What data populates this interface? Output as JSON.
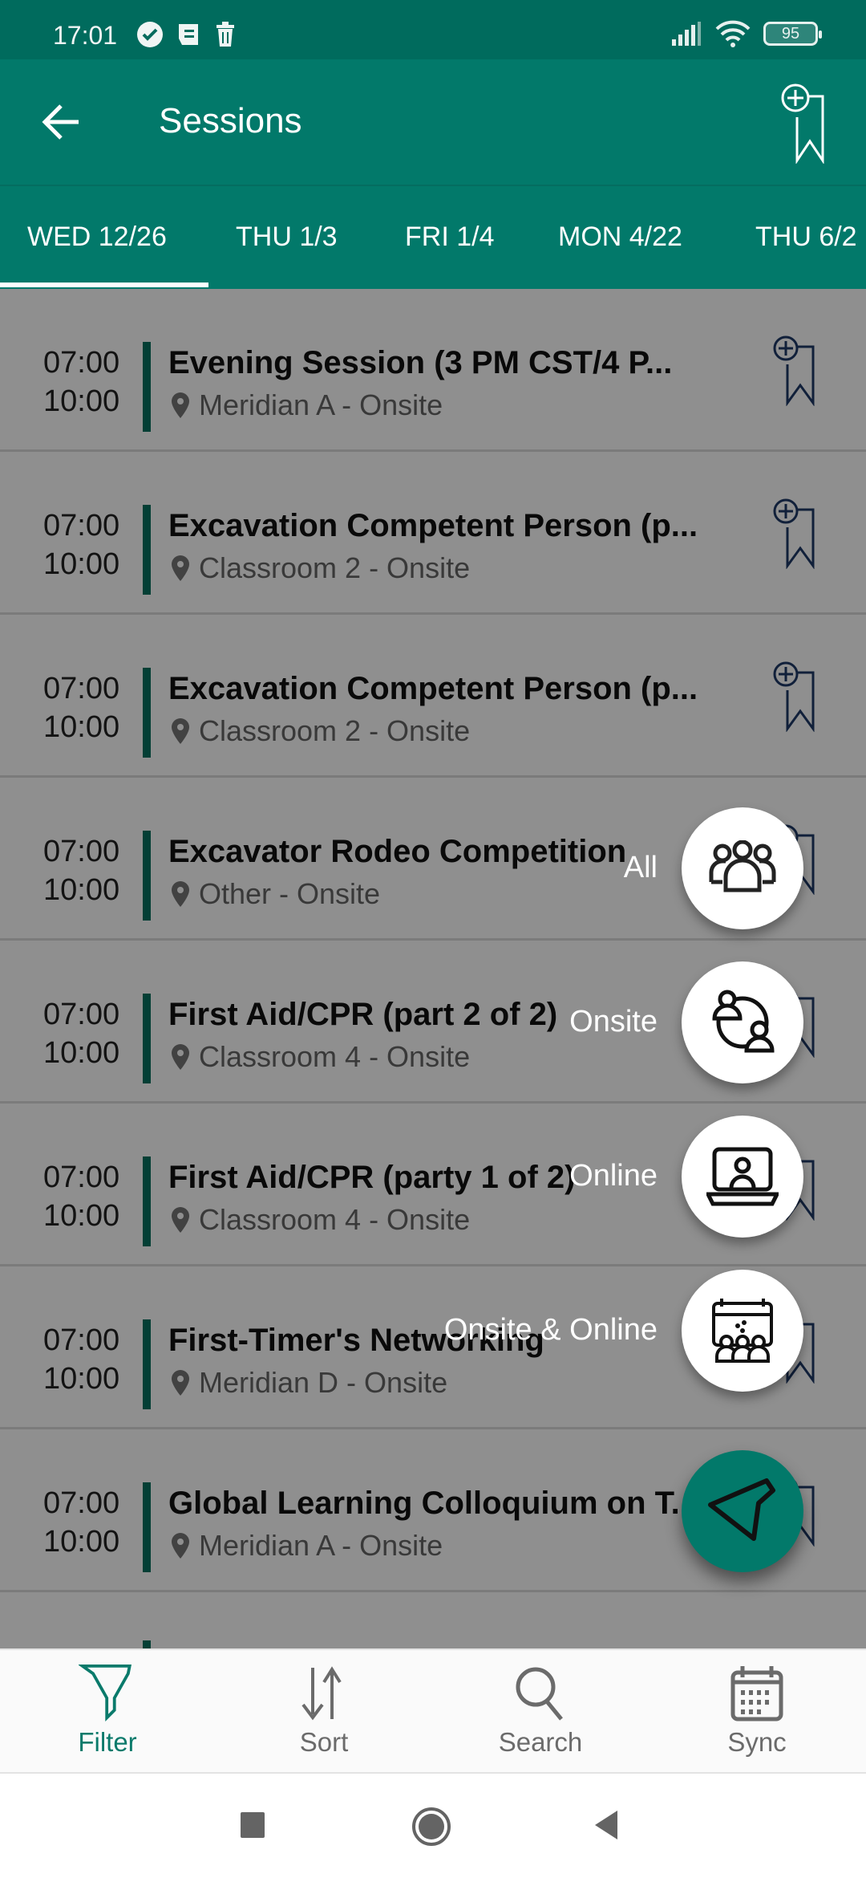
{
  "status_bar": {
    "time": "17:01",
    "left_icons": [
      "check-circle-icon",
      "notes-icon",
      "trash-icon"
    ],
    "right_icons": [
      "signal-icon",
      "wifi-icon",
      "battery-icon"
    ],
    "battery_level": "95"
  },
  "app_bar": {
    "title": "Sessions",
    "back_icon": "arrow-left-icon",
    "action_icon": "bookmark-add-icon"
  },
  "tabs": [
    {
      "label": "WED 12/26",
      "selected": true
    },
    {
      "label": "THU 1/3",
      "selected": false
    },
    {
      "label": "FRI 1/4",
      "selected": false
    },
    {
      "label": "MON 4/22",
      "selected": false
    },
    {
      "label": "THU 6/2",
      "selected": false
    }
  ],
  "sessions": [
    {
      "start": "07:00",
      "end": "10:00",
      "title": "Evening Session (3 PM CST/4 P...",
      "location": "Meridian A - Onsite"
    },
    {
      "start": "07:00",
      "end": "10:00",
      "title": "Excavation Competent Person (p...",
      "location": "Classroom 2 - Onsite"
    },
    {
      "start": "07:00",
      "end": "10:00",
      "title": "Excavation Competent Person (p...",
      "location": "Classroom 2 - Onsite"
    },
    {
      "start": "07:00",
      "end": "10:00",
      "title": "Excavator Rodeo Competition",
      "location": "Other - Onsite"
    },
    {
      "start": "07:00",
      "end": "10:00",
      "title": "First Aid/CPR (part 2 of 2)",
      "location": "Classroom 4 - Onsite"
    },
    {
      "start": "07:00",
      "end": "10:00",
      "title": "First Aid/CPR (party 1 of 2)",
      "location": "Classroom 4 - Onsite"
    },
    {
      "start": "07:00",
      "end": "10:00",
      "title": "First-Timer's Networking",
      "location": "Meridian D - Onsite"
    },
    {
      "start": "07:00",
      "end": "10:00",
      "title": "Global Learning Colloquium on T...",
      "location": "Meridian A - Onsite"
    }
  ],
  "filter_menu": {
    "options": [
      {
        "label": "All",
        "icon": "group-icon"
      },
      {
        "label": "Onsite",
        "icon": "onsite-people-icon"
      },
      {
        "label": "Online",
        "icon": "laptop-user-icon"
      },
      {
        "label": "Onsite & Online",
        "icon": "calendar-audience-icon"
      }
    ],
    "main_icon": "filter-funnel-icon"
  },
  "bottom_nav": {
    "items": [
      {
        "label": "Filter",
        "icon": "filter-icon",
        "active": true
      },
      {
        "label": "Sort",
        "icon": "sort-icon",
        "active": false
      },
      {
        "label": "Search",
        "icon": "search-icon",
        "active": false
      },
      {
        "label": "Sync",
        "icon": "calendar-icon",
        "active": false
      }
    ]
  },
  "colors": {
    "primary": "#02796a",
    "status_bar": "#006b5d",
    "accent_bar": "#07705f",
    "bookmark": "#1f3a68"
  }
}
